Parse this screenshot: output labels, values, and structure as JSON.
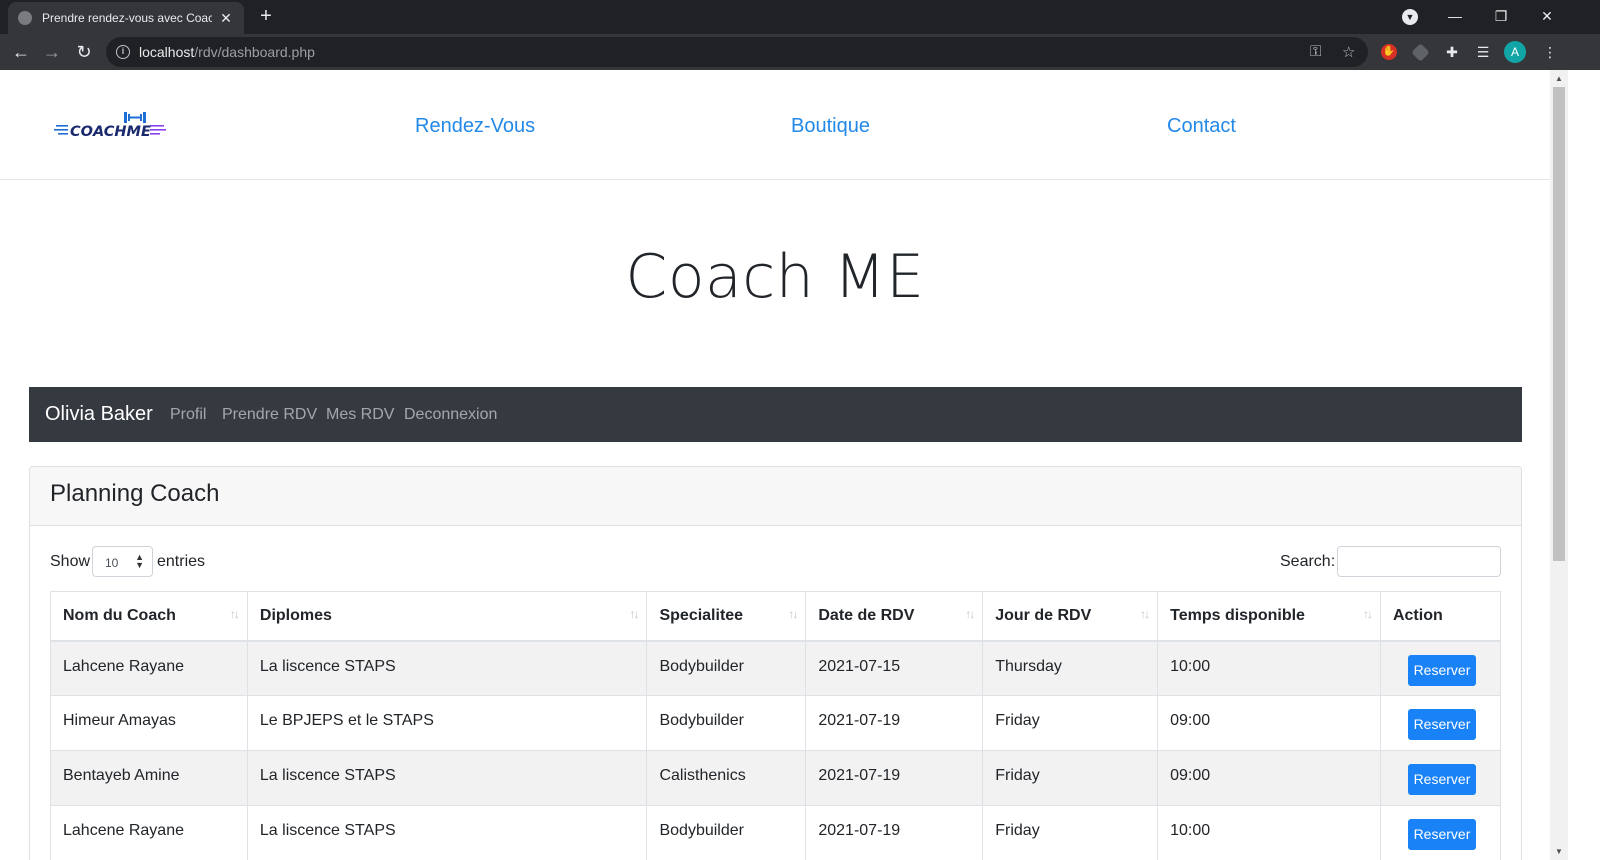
{
  "browser": {
    "tab_title": "Prendre rendez-vous avec Coach",
    "url_host": "localhost",
    "url_path": "/rdv/dashboard.php",
    "avatar_letter": "A"
  },
  "site": {
    "logo_text": "COACHME",
    "nav_links": [
      "Rendez-Vous",
      "Boutique",
      "Contact"
    ],
    "hero_title": "Coach ME"
  },
  "user_nav": {
    "brand": "Olivia Baker",
    "links": [
      "Profil",
      "Prendre RDV",
      "Mes RDV",
      "Deconnexion"
    ]
  },
  "planning": {
    "title": "Planning Coach",
    "show_label": "Show",
    "page_length": "10",
    "entries_label": "entries",
    "search_label": "Search:",
    "search_value": "",
    "columns": [
      "Nom du Coach",
      "Diplomes",
      "Specialitee",
      "Date de RDV",
      "Jour de RDV",
      "Temps disponible",
      "Action"
    ],
    "action_label": "Reserver",
    "rows": [
      [
        "Lahcene Rayane",
        "La liscence STAPS",
        "Bodybuilder",
        "2021-07-15",
        "Thursday",
        "10:00"
      ],
      [
        "Himeur Amayas",
        "Le BPJEPS et le STAPS",
        "Bodybuilder",
        "2021-07-19",
        "Friday",
        "09:00"
      ],
      [
        "Bentayeb Amine",
        "La liscence STAPS",
        "Calisthenics",
        "2021-07-19",
        "Friday",
        "09:00"
      ],
      [
        "Lahcene Rayane",
        "La liscence STAPS",
        "Bodybuilder",
        "2021-07-19",
        "Friday",
        "10:00"
      ]
    ]
  },
  "colors": {
    "link_blue": "#2389e8",
    "navbar_dark": "#343a40",
    "button_primary": "#1a82f7",
    "logo_blue": "#1d6fd6",
    "logo_purple": "#8a3ff0"
  }
}
